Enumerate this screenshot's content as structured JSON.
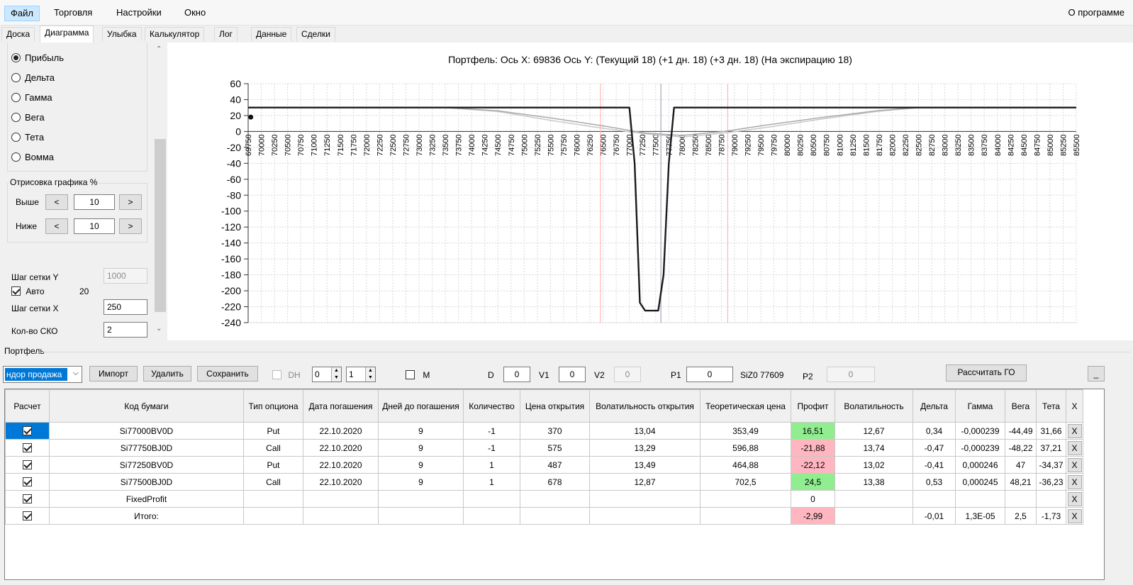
{
  "menu": {
    "items": [
      "Файл",
      "Торговля",
      "Настройки",
      "Окно"
    ],
    "about": "О программе"
  },
  "tabs": [
    "Доска",
    "Диаграмма",
    "Улыбка",
    "Калькулятор",
    "Лог",
    "Данные",
    "Сделки"
  ],
  "left": {
    "radios": [
      {
        "label": "Прибыль",
        "checked": true
      },
      {
        "label": "Дельта",
        "checked": false
      },
      {
        "label": "Гамма",
        "checked": false
      },
      {
        "label": "Вега",
        "checked": false
      },
      {
        "label": "Тета",
        "checked": false
      },
      {
        "label": "Вомма",
        "checked": false
      }
    ],
    "render_group_title": "Отрисовка графика %",
    "above_label": "Выше",
    "above_value": "10",
    "below_label": "Ниже",
    "below_value": "10",
    "prev_glyph": "<",
    "next_glyph": ">",
    "grid_y_label": "Шаг сетки Y",
    "grid_y_value": "1000",
    "auto_label": "Авто",
    "auto_value": "20",
    "grid_x_label": "Шаг сетки X",
    "grid_x_value": "250",
    "sko_label": "Кол-во СКО",
    "sko_value": "2"
  },
  "chart_title": "Портфель: Ось X:  69836 Ось Y:  (Текущий 18)  (+1 дн. 18)  (+3 дн. 18)  (На экспирацию 18)",
  "chart_data": {
    "type": "line",
    "title": "Портфель: Ось X:  69836 Ось Y:  (Текущий 18)  (+1 дн. 18)  (+3 дн. 18)  (На экспирацию 18)",
    "xlim": [
      69750,
      85500
    ],
    "ylim": [
      -240,
      60
    ],
    "x_ticks": [
      69750,
      70000,
      70250,
      70500,
      70750,
      71000,
      71250,
      71500,
      71750,
      72000,
      72250,
      72500,
      72750,
      73000,
      73250,
      73500,
      73750,
      74000,
      74250,
      74500,
      74750,
      75000,
      75250,
      75500,
      75750,
      76000,
      76250,
      76500,
      76750,
      77000,
      77250,
      77500,
      77750,
      78000,
      78250,
      78500,
      78750,
      79000,
      79250,
      79500,
      79750,
      80000,
      80250,
      80500,
      80750,
      81000,
      81250,
      81500,
      81750,
      82000,
      82250,
      82500,
      82750,
      83000,
      83250,
      83500,
      83750,
      84000,
      84250,
      84500,
      84750,
      85000,
      85250,
      85500
    ],
    "y_ticks": [
      60,
      40,
      20,
      0,
      -20,
      -40,
      -60,
      -80,
      -100,
      -120,
      -140,
      -160,
      -180,
      -200,
      -220,
      -240
    ],
    "grid": true,
    "series": [
      {
        "color": "#1a1a1a",
        "x": [
          69750,
          76900,
          77000,
          77100,
          77200,
          77300,
          77550,
          77650,
          77750,
          77850,
          85500
        ],
        "y": [
          30,
          30,
          30,
          -40,
          -215,
          -225,
          -225,
          -180,
          -40,
          30,
          30
        ]
      },
      {
        "color": "#aaaaaa",
        "x": [
          69750,
          73500,
          74500,
          75500,
          76500,
          77300,
          78000,
          78800,
          79600,
          80600,
          81700,
          82500,
          85500
        ],
        "y": [
          30,
          30,
          26,
          17,
          7,
          -2,
          -5,
          0,
          8,
          17,
          26,
          30,
          30
        ]
      },
      {
        "color": "#c8c8c8",
        "x": [
          69750,
          73500,
          74500,
          75500,
          76500,
          77300,
          78000,
          78800,
          79600,
          80600,
          81700,
          82500,
          85500
        ],
        "y": [
          30,
          30,
          25,
          14,
          4,
          -3,
          -7,
          -2,
          5,
          15,
          25,
          30,
          30
        ]
      }
    ],
    "vlines": [
      {
        "x": 76450,
        "color": "#ffaaaa"
      },
      {
        "x": 77600,
        "color": "#8899aa"
      },
      {
        "x": 78870,
        "color": "#ffaaaa"
      }
    ],
    "point": {
      "x": 69800,
      "y": 18
    }
  },
  "portfolio_title": "Портфель",
  "toolbar": {
    "combo_value": "ндор продажа",
    "import": "Импорт",
    "delete": "Удалить",
    "save": "Сохранить",
    "dh_label": "DH",
    "spin1": "0",
    "spin2": "1",
    "m_label": "M",
    "d_label": "D",
    "d_value": "0",
    "v1_label": "V1",
    "v1_value": "0",
    "v2_label": "V2",
    "v2_value": "0",
    "p1_label": "P1",
    "p1_value": "0",
    "sizo_label": "SiZ0 77609",
    "p2_label": "P2",
    "p2_value": "0",
    "calc_go": "Рассчитать ГО",
    "minimize": "_"
  },
  "table": {
    "headers": [
      "Расчет",
      "Код бумаги",
      "Тип опциона",
      "Дата погашения",
      "Дней до погашения",
      "Количество",
      "Цена открытия",
      "Волатильность открытия",
      "Теоретическая цена",
      "Профит",
      "Волатильность",
      "Дельта",
      "Гамма",
      "Вега",
      "Тета",
      "X"
    ],
    "rows": [
      [
        "Si77000BV0D",
        "Put",
        "22.10.2020",
        "9",
        "-1",
        "370",
        "13,04",
        "353,49",
        "16,51",
        "12,67",
        "0,34",
        "-0,000239",
        "-44,49",
        "31,66"
      ],
      [
        "Si77750BJ0D",
        "Call",
        "22.10.2020",
        "9",
        "-1",
        "575",
        "13,29",
        "596,88",
        "-21,88",
        "13,74",
        "-0,47",
        "-0,000239",
        "-48,22",
        "37,21"
      ],
      [
        "Si77250BV0D",
        "Put",
        "22.10.2020",
        "9",
        "1",
        "487",
        "13,49",
        "464,88",
        "-22,12",
        "13,02",
        "-0,41",
        "0,000246",
        "47",
        "-34,37"
      ],
      [
        "Si77500BJ0D",
        "Call",
        "22.10.2020",
        "9",
        "1",
        "678",
        "12,87",
        "702,5",
        "24,5",
        "13,38",
        "0,53",
        "0,000245",
        "48,21",
        "-36,23"
      ],
      [
        "FixedProfit",
        "",
        "",
        "",
        "",
        "",
        "",
        "",
        "0",
        "",
        "",
        "",
        "",
        ""
      ],
      [
        "Итого:",
        "",
        "",
        "",
        "",
        "",
        "",
        "",
        "-2,99",
        "",
        "-0,01",
        "1,3E-05",
        "2,5",
        "-1,73"
      ]
    ],
    "profit_colors": [
      "green",
      "pink",
      "pink",
      "green",
      "",
      "pink"
    ],
    "x_label": "X"
  }
}
